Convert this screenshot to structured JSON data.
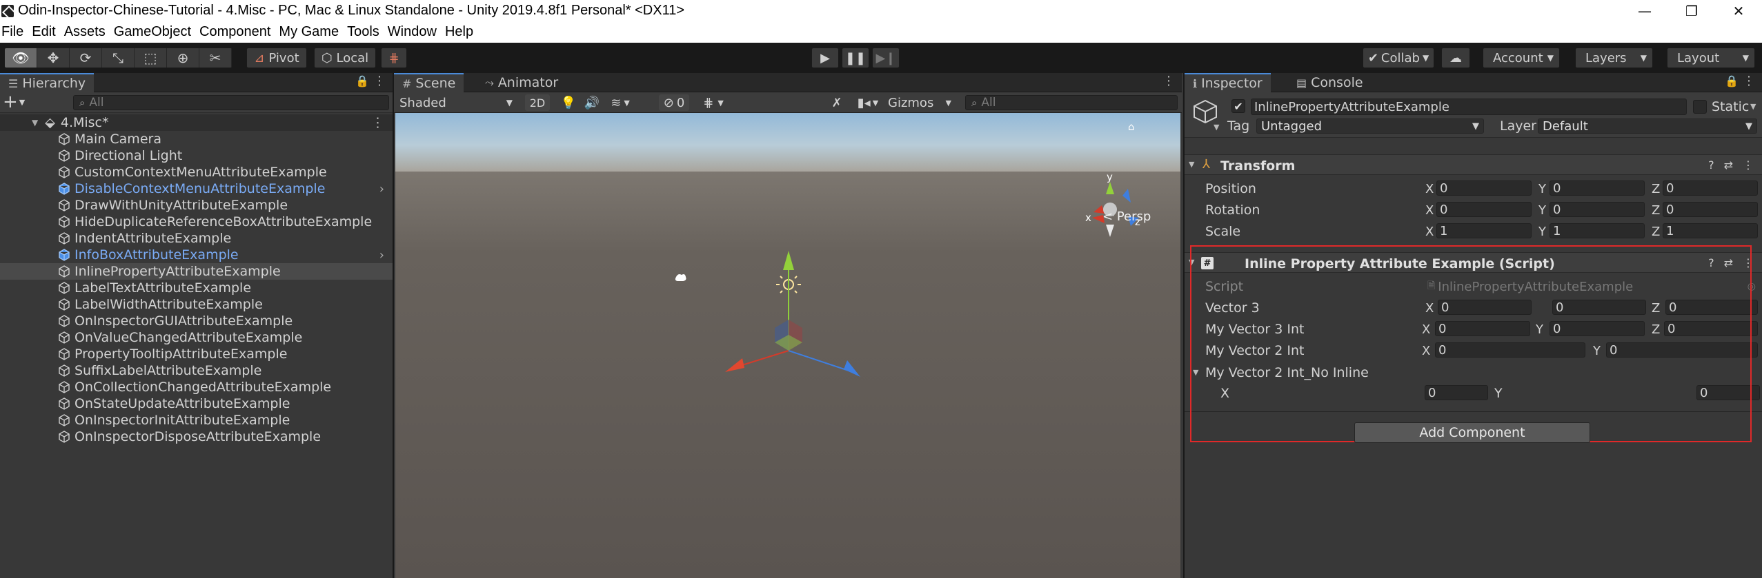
{
  "window": {
    "title": "Odin-Inspector-Chinese-Tutorial - 4.Misc - PC, Mac & Linux Standalone - Unity 2019.4.8f1 Personal* <DX11>",
    "controls": [
      "—",
      "❐",
      "✕"
    ]
  },
  "menu": [
    "File",
    "Edit",
    "Assets",
    "GameObject",
    "Component",
    "My Game",
    "Tools",
    "Window",
    "Help"
  ],
  "toolbar": {
    "pivot_label": "Pivot",
    "local_label": "Local",
    "collab_label": "Collab",
    "account_label": "Account",
    "layers_label": "Layers",
    "layout_label": "Layout"
  },
  "hierarchy": {
    "tab_label": "Hierarchy",
    "add_label": "+",
    "search_placeholder": "All",
    "scene_name": "4.Misc*",
    "items": [
      {
        "label": "Main Camera",
        "prefab": false,
        "arrow": false,
        "selected": false
      },
      {
        "label": "Directional Light",
        "prefab": false,
        "arrow": false,
        "selected": false
      },
      {
        "label": "CustomContextMenuAttributeExample",
        "prefab": false,
        "arrow": false,
        "selected": false
      },
      {
        "label": "DisableContextMenuAttributeExample",
        "prefab": true,
        "arrow": true,
        "selected": false
      },
      {
        "label": "DrawWithUnityAttributeExample",
        "prefab": false,
        "arrow": false,
        "selected": false
      },
      {
        "label": "HideDuplicateReferenceBoxAttributeExample",
        "prefab": false,
        "arrow": false,
        "selected": false
      },
      {
        "label": "IndentAttributeExample",
        "prefab": false,
        "arrow": false,
        "selected": false
      },
      {
        "label": "InfoBoxAttributeExample",
        "prefab": true,
        "arrow": true,
        "selected": false
      },
      {
        "label": "InlinePropertyAttributeExample",
        "prefab": false,
        "arrow": false,
        "selected": true
      },
      {
        "label": "LabelTextAttributeExample",
        "prefab": false,
        "arrow": false,
        "selected": false
      },
      {
        "label": "LabelWidthAttributeExample",
        "prefab": false,
        "arrow": false,
        "selected": false
      },
      {
        "label": "OnInspectorGUIAttributeExample",
        "prefab": false,
        "arrow": false,
        "selected": false
      },
      {
        "label": "OnValueChangedAttributeExample",
        "prefab": false,
        "arrow": false,
        "selected": false
      },
      {
        "label": "PropertyTooltipAttributeExample",
        "prefab": false,
        "arrow": false,
        "selected": false
      },
      {
        "label": "SuffixLabelAttributeExample",
        "prefab": false,
        "arrow": false,
        "selected": false
      },
      {
        "label": "OnCollectionChangedAttributeExample",
        "prefab": false,
        "arrow": false,
        "selected": false
      },
      {
        "label": "OnStateUpdateAttributeExample",
        "prefab": false,
        "arrow": false,
        "selected": false
      },
      {
        "label": "OnInspectorInitAttributeExample",
        "prefab": false,
        "arrow": false,
        "selected": false
      },
      {
        "label": "OnInspectorDisposeAttributeExample",
        "prefab": false,
        "arrow": false,
        "selected": false
      }
    ]
  },
  "scene": {
    "tab_scene": "Scene",
    "tab_animator": "Animator",
    "shading_mode": "Shaded",
    "mode_2d": "2D",
    "hidden_count": "0",
    "gizmos_label": "Gizmos",
    "search_placeholder": "All",
    "persp_label": "Persp",
    "axis_x": "x",
    "axis_y": "y",
    "axis_z": "z"
  },
  "inspector": {
    "tab_inspector": "Inspector",
    "tab_console": "Console",
    "object_name": "InlinePropertyAttributeExample",
    "static_label": "Static",
    "tag_label": "Tag",
    "tag_value": "Untagged",
    "layer_label": "Layer",
    "layer_value": "Default",
    "transform": {
      "title": "Transform",
      "position_label": "Position",
      "rotation_label": "Rotation",
      "scale_label": "Scale",
      "position": {
        "x": "0",
        "y": "0",
        "z": "0"
      },
      "rotation": {
        "x": "0",
        "y": "0",
        "z": "0"
      },
      "scale": {
        "x": "1",
        "y": "1",
        "z": "1"
      }
    },
    "script_component": {
      "title": "Inline Property Attribute Example (Script)",
      "script_label": "Script",
      "script_value": "InlinePropertyAttributeExample",
      "vector3_label": "Vector 3",
      "vector3": {
        "x": "0",
        "y": "0",
        "z": "0"
      },
      "myvector3int_label": "My Vector 3 Int",
      "myvector3int": {
        "x": "0",
        "y": "0",
        "z": "0"
      },
      "myvector2int_label": "My Vector 2 Int",
      "myvector2int": {
        "x": "0",
        "y": "0"
      },
      "noinline_label": "My Vector 2 Int_No Inline",
      "noinline_x_label": "X",
      "noinline_y_label": "Y",
      "noinline": {
        "x": "0",
        "y": "0"
      }
    },
    "add_component_label": "Add Component",
    "axis_labels": {
      "x": "X",
      "y": "Y",
      "z": "Z"
    }
  },
  "colors": {
    "accent": "#4a8ad8",
    "prefab_blue": "#7aabf5",
    "highlight_red": "#e02929"
  }
}
